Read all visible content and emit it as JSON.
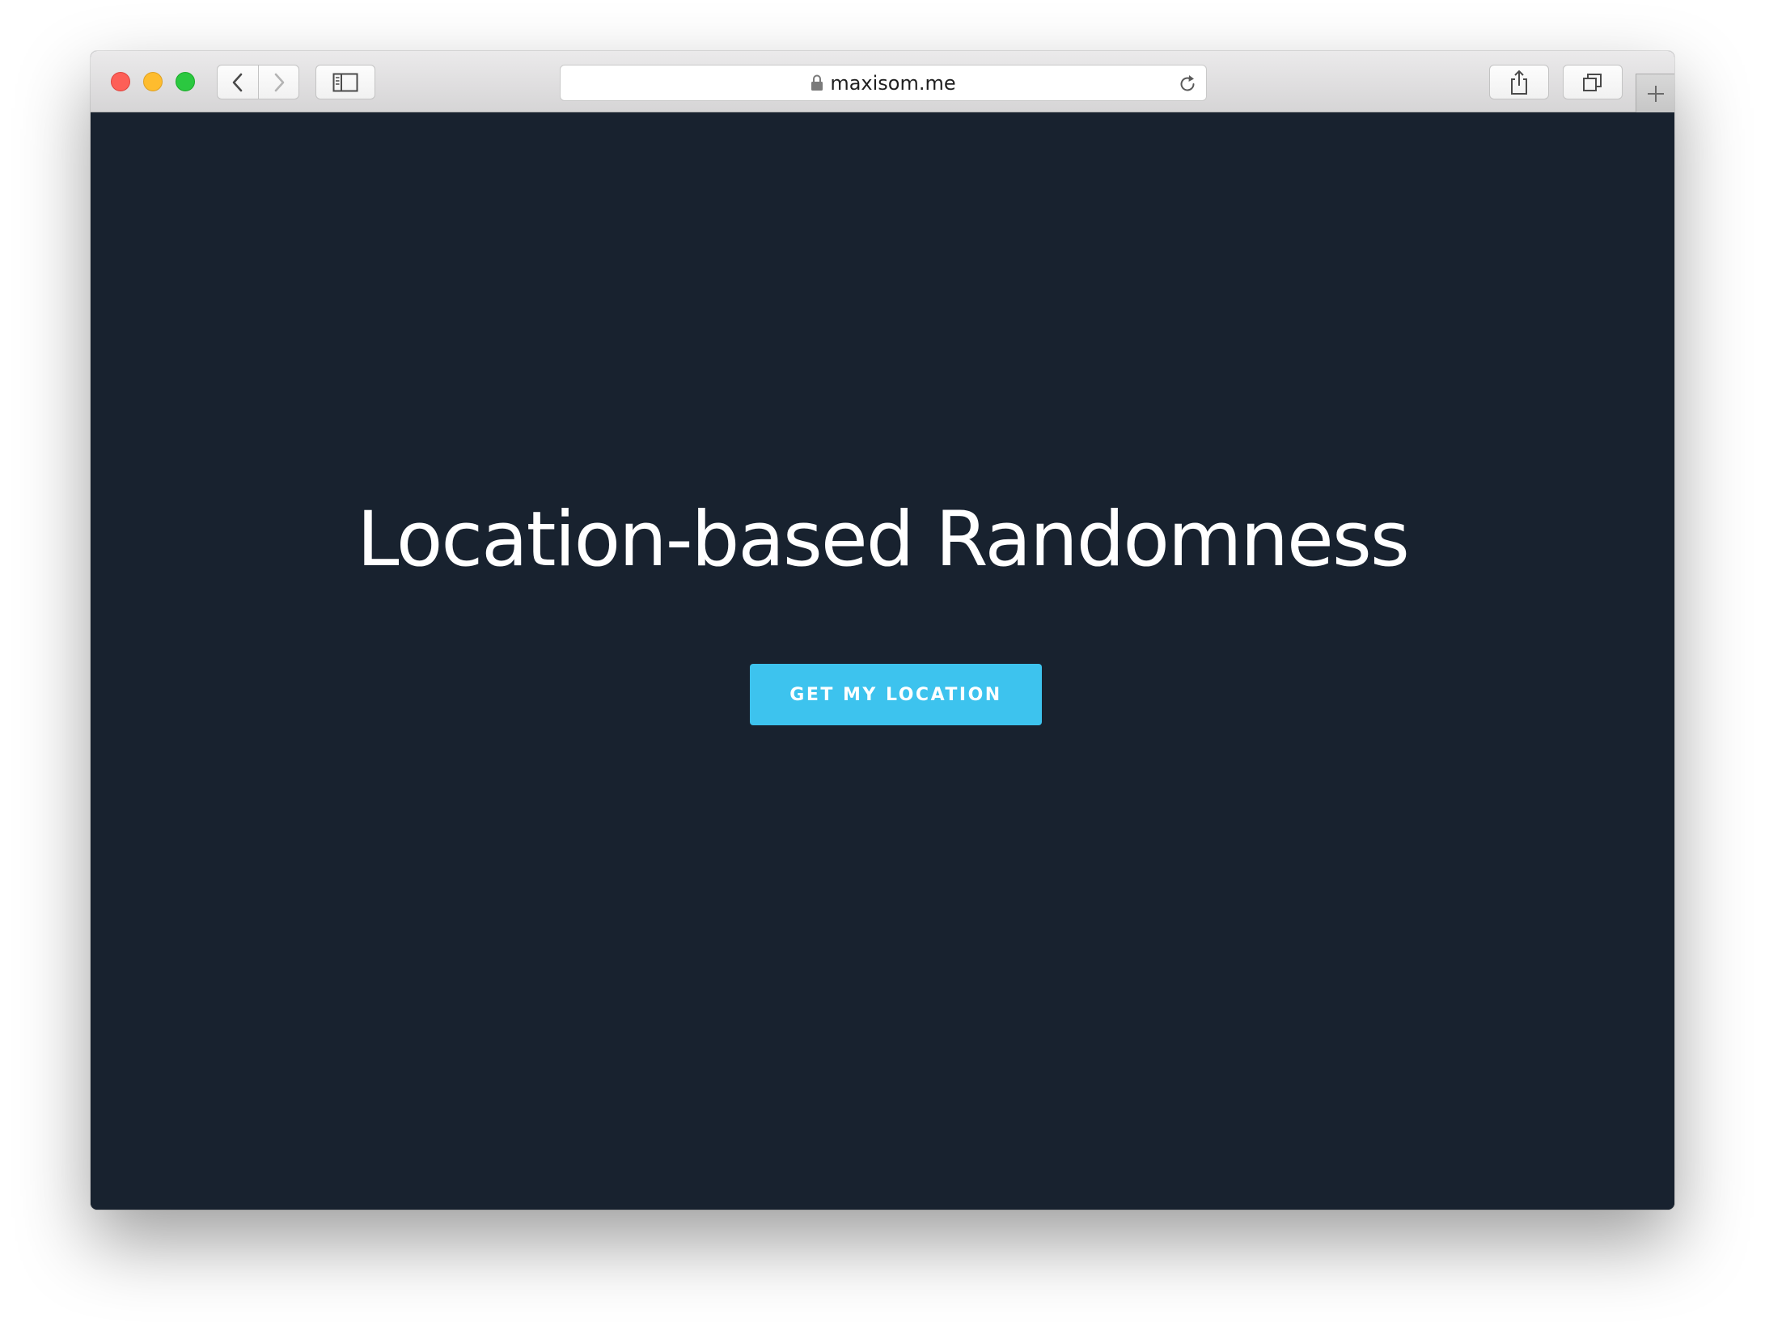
{
  "browser": {
    "url": "maxisom.me",
    "icons": {
      "back": "chevron-left-icon",
      "forward": "chevron-right-icon",
      "sidebar": "sidebar-icon",
      "lock": "lock-icon",
      "reload": "reload-icon",
      "share": "share-icon",
      "tabs": "tabs-overview-icon",
      "new_tab": "plus-icon"
    },
    "traffic_light_colors": {
      "close": "#fd5f57",
      "minimize": "#febc2e",
      "zoom": "#2bc840"
    }
  },
  "page": {
    "background_color": "#18222f",
    "heading": "Location-based Randomness",
    "cta_label": "GET MY LOCATION",
    "cta_color": "#3dc3ee"
  }
}
